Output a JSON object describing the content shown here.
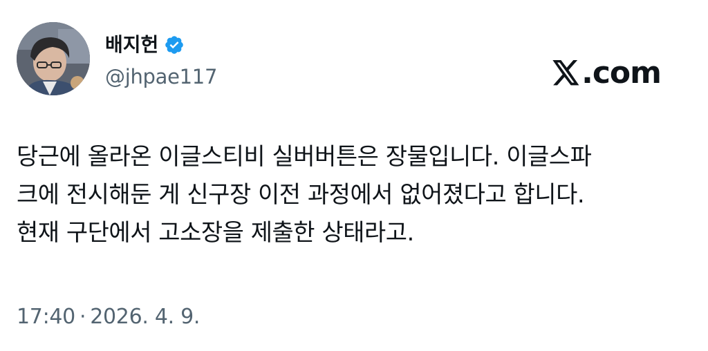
{
  "author": {
    "display_name": "배지헌",
    "handle": "@jhpae117",
    "verified": true,
    "avatar_icon": "profile-photo",
    "verified_color": "#1d9bf0"
  },
  "brand": {
    "logo_icon": "x-logo-icon",
    "text": ".com"
  },
  "tweet": {
    "lines": [
      "당근에 올라온 이글스티비 실버버튼은 장물입니다. 이글스파",
      "크에 전시해둔 게 신구장 이전 과정에서 없어졌다고 합니다.",
      "현재 구단에서 고소장을 제출한 상태라고."
    ]
  },
  "meta": {
    "time": "17:40",
    "separator": "·",
    "date": "2026. 4. 9."
  },
  "colors": {
    "text": "#0f1419",
    "secondary": "#536471",
    "accent": "#1d9bf0"
  }
}
